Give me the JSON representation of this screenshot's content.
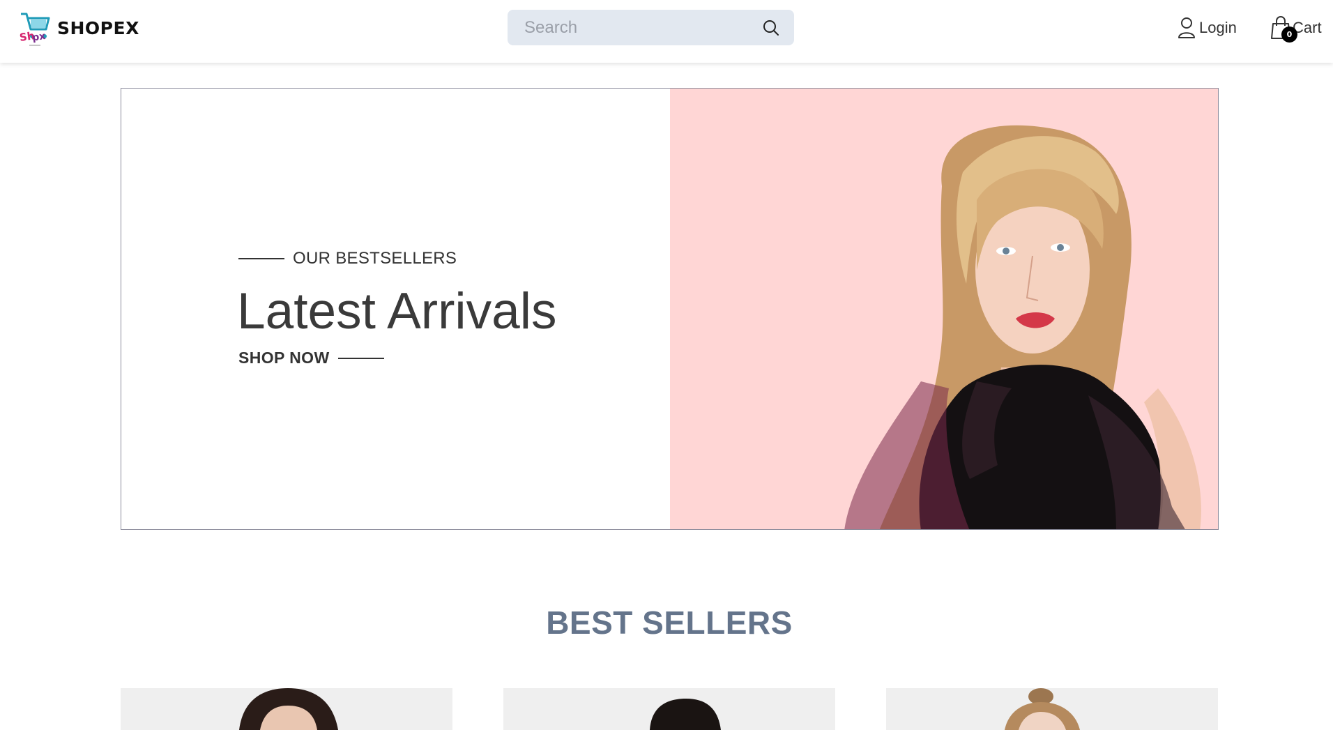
{
  "brand": {
    "name": "SHOPEX",
    "logo_text": "SHOPEX"
  },
  "search": {
    "placeholder": "Search",
    "value": ""
  },
  "nav": {
    "login_label": "Login",
    "cart_label": "Cart",
    "cart_count": "0"
  },
  "hero": {
    "kicker": "OUR BESTSELLERS",
    "title": "Latest Arrivals",
    "cta": "SHOP NOW",
    "background_color": "#ffd6d5"
  },
  "best_sellers": {
    "title": "BEST SELLERS",
    "products": [
      {
        "name": ""
      },
      {
        "name": ""
      },
      {
        "name": ""
      }
    ]
  },
  "icons": {
    "search": "search-icon",
    "login": "user-icon",
    "cart": "shopping-bag-icon",
    "logo": "shopping-cart-logo"
  },
  "colors": {
    "header_bg": "#ffffff",
    "search_bg": "#e2e8f0",
    "section_title": "#64748b",
    "badge_bg": "#000000"
  }
}
